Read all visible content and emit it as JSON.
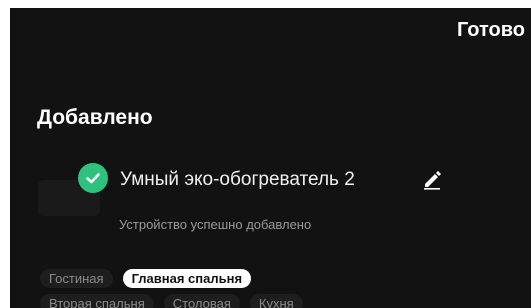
{
  "header": {
    "done_label": "Готово"
  },
  "section": {
    "title": "Добавлено"
  },
  "device": {
    "name": "Умный эко-обогреватель 2",
    "status": "Устройство успешно добавлено"
  },
  "rooms": {
    "row1": [
      "Гостиная",
      "Главная спальня"
    ],
    "row2": [
      "Вторая спальня",
      "Столовая",
      "Кухня"
    ],
    "selected": "Главная спальня"
  },
  "colors": {
    "background": "#121212",
    "accent_success": "#2ec27e",
    "selected_chip": "#ffffff"
  },
  "icons": {
    "check": "check-circle-icon",
    "edit": "pencil-icon"
  }
}
